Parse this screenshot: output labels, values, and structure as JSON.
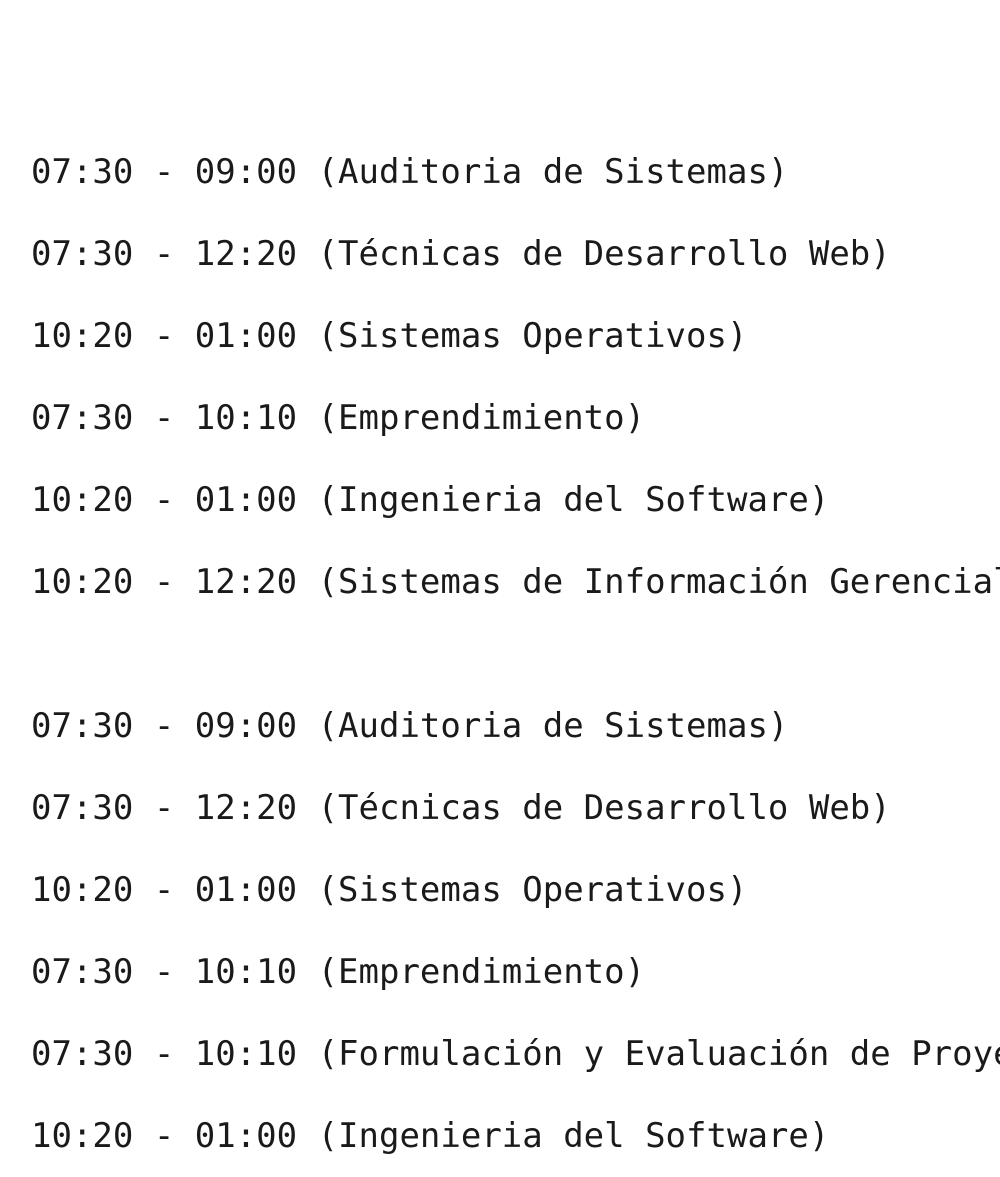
{
  "schedules": [
    {
      "lines": [
        "07:30 - 09:00 (Auditoria de Sistemas)",
        "07:30 - 12:20 (Técnicas de Desarrollo Web)",
        "10:20 - 01:00 (Sistemas Operativos)",
        "07:30 - 10:10 (Emprendimiento)",
        "10:20 - 01:00 (Ingenieria del Software)",
        "10:20 - 12:20 (Sistemas de Información Gerencial"
      ]
    },
    {
      "lines": [
        "07:30 - 09:00 (Auditoria de Sistemas)",
        "07:30 - 12:20 (Técnicas de Desarrollo Web)",
        "10:20 - 01:00 (Sistemas Operativos)",
        "07:30 - 10:10 (Emprendimiento)",
        "07:30 - 10:10 (Formulación y Evaluación de Proye",
        "10:20 - 01:00 (Ingenieria del Software)"
      ]
    }
  ]
}
